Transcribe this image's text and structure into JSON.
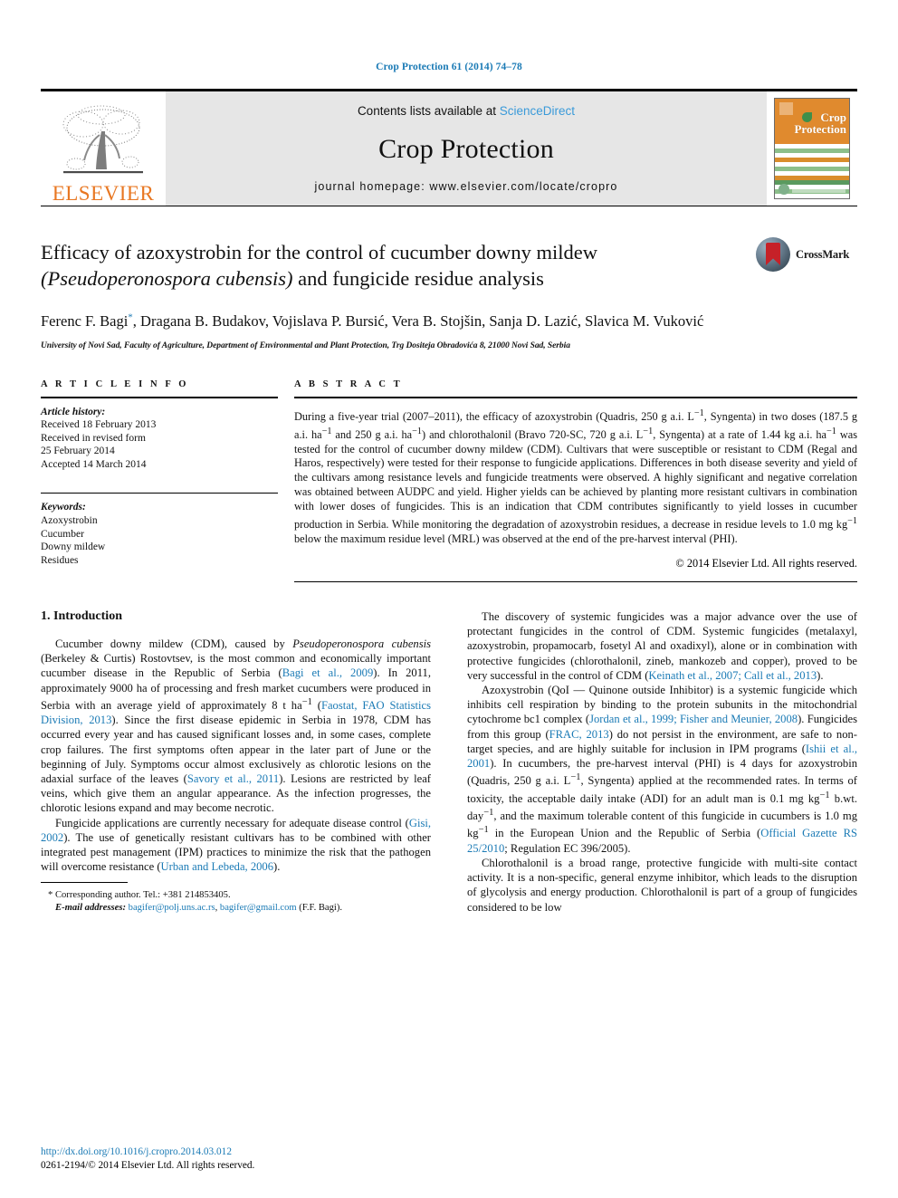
{
  "running_head": "Crop Protection 61 (2014) 74–78",
  "banner": {
    "publisher": "ELSEVIER",
    "contents_prefix": "Contents lists available at ",
    "contents_link": "ScienceDirect",
    "journal_name": "Crop Protection",
    "homepage": "journal homepage: www.elsevier.com/locate/cropro",
    "cover_title_line1": "Crop",
    "cover_title_line2": "Protection",
    "cover_stripe_colors": [
      "#ffffff",
      "#8cbf8a",
      "#ffffff",
      "#d98d2b",
      "#ffffff",
      "#8cbf8a",
      "#ffffff",
      "#d98d2b",
      "#5a9a5f",
      "#ffffff",
      "#8cbf8a",
      "#ffffff",
      "#d98d2b"
    ]
  },
  "article": {
    "title_line1": "Efficacy of azoxystrobin for the control of cucumber downy mildew",
    "title_italic": "(Pseudoperonospora cubensis)",
    "title_line2_rest": " and fungicide residue analysis",
    "crossmark_label": "CrossMark",
    "authors": "Ferenc F. Bagi, Dragana B. Budakov, Vojislava P. Bursić, Vera B. Stojšin, Sanja D. Lazić, Slavica M. Vuković",
    "author_star": "*",
    "affiliation": "University of Novi Sad, Faculty of Agriculture, Department of Environmental and Plant Protection, Trg Dositeja Obradovića 8, 21000 Novi Sad, Serbia"
  },
  "info": {
    "heading": "A R T I C L E   I N F O",
    "history_label": "Article history:",
    "history": [
      "Received 18 February 2013",
      "Received in revised form",
      "25 February 2014",
      "Accepted 14 March 2014"
    ],
    "keywords_label": "Keywords:",
    "keywords": [
      "Azoxystrobin",
      "Cucumber",
      "Downy mildew",
      "Residues"
    ]
  },
  "abstract": {
    "heading": "A B S T R A C T",
    "text": "During a five-year trial (2007–2011), the efficacy of azoxystrobin (Quadris, 250 g a.i. L−1, Syngenta) in two doses (187.5 g a.i. ha−1 and 250 g a.i. ha−1) and chlorothalonil (Bravo 720-SC, 720 g a.i. L−1, Syngenta) at a rate of 1.44 kg a.i. ha−1 was tested for the control of cucumber downy mildew (CDM). Cultivars that were susceptible or resistant to CDM (Regal and Haros, respectively) were tested for their response to fungicide applications. Differences in both disease severity and yield of the cultivars among resistance levels and fungicide treatments were observed. A highly significant and negative correlation was obtained between AUDPC and yield. Higher yields can be achieved by planting more resistant cultivars in combination with lower doses of fungicides. This is an indication that CDM contributes significantly to yield losses in cucumber production in Serbia. While monitoring the degradation of azoxystrobin residues, a decrease in residue levels to 1.0 mg kg−1 below the maximum residue level (MRL) was observed at the end of the pre-harvest interval (PHI).",
    "copyright": "© 2014 Elsevier Ltd. All rights reserved."
  },
  "body": {
    "section_number_title": "1.  Introduction",
    "left_paragraphs": [
      {
        "runs": [
          {
            "t": "Cucumber downy mildew (CDM), caused by "
          },
          {
            "t": "Pseudoperonospora cubensis",
            "s": "i"
          },
          {
            "t": " (Berkeley & Curtis) Rostovtsev, is the most common and economically important cucumber disease in the Republic of Serbia ("
          },
          {
            "t": "Bagi et al., 2009",
            "s": "ref"
          },
          {
            "t": "). In 2011, approximately 9000 ha of processing and fresh market cucumbers were produced in Serbia with an average yield of approximately 8 t ha"
          },
          {
            "t": "−1",
            "s": "sup"
          },
          {
            "t": " ("
          },
          {
            "t": "Faostat, FAO Statistics Division, 2013",
            "s": "ref"
          },
          {
            "t": "). Since the first disease epidemic in Serbia in 1978, CDM has occurred every year and has caused significant losses and, in some cases, complete crop failures. The first symptoms often appear in the later part of June or the beginning of July. Symptoms occur almost exclusively as chlorotic lesions on the adaxial surface of the leaves ("
          },
          {
            "t": "Savory et al., 2011",
            "s": "ref"
          },
          {
            "t": "). Lesions are restricted by leaf veins, which give them an angular appearance. As the infection progresses, the chlorotic lesions expand and may become necrotic."
          }
        ]
      },
      {
        "runs": [
          {
            "t": "Fungicide applications are currently necessary for adequate disease control ("
          },
          {
            "t": "Gisi, 2002",
            "s": "ref"
          },
          {
            "t": "). The use of genetically resistant cultivars has to be combined with other integrated pest management (IPM) practices to minimize the risk that the pathogen will overcome resistance ("
          },
          {
            "t": "Urban and Lebeda, 2006",
            "s": "ref"
          },
          {
            "t": ")."
          }
        ]
      }
    ],
    "right_paragraphs": [
      {
        "runs": [
          {
            "t": "The discovery of systemic fungicides was a major advance over the use of protectant fungicides in the control of CDM. Systemic fungicides (metalaxyl, azoxystrobin, propamocarb, fosetyl Al and oxadixyl), alone or in combination with protective fungicides (chlorothalonil, zineb, mankozeb and copper), proved to be very successful in the control of CDM ("
          },
          {
            "t": "Keinath et al., 2007; Call et al., 2013",
            "s": "ref"
          },
          {
            "t": ")."
          }
        ]
      },
      {
        "runs": [
          {
            "t": "Azoxystrobin (QoI — Quinone outside Inhibitor) is a systemic fungicide which inhibits cell respiration by binding to the protein subunits in the mitochondrial cytochrome bc1 complex ("
          },
          {
            "t": "Jordan et al., 1999; Fisher and Meunier, 2008",
            "s": "ref"
          },
          {
            "t": "). Fungicides from this group ("
          },
          {
            "t": "FRAC, 2013",
            "s": "ref"
          },
          {
            "t": ") do not persist in the environment, are safe to non-target species, and are highly suitable for inclusion in IPM programs ("
          },
          {
            "t": "Ishii et al., 2001",
            "s": "ref"
          },
          {
            "t": "). In cucumbers, the pre-harvest interval (PHI) is 4 days for azoxystrobin (Quadris, 250 g a.i. L"
          },
          {
            "t": "−1",
            "s": "sup"
          },
          {
            "t": ", Syngenta) applied at the recommended rates. In terms of toxicity, the acceptable daily intake (ADI) for an adult man is 0.1 mg kg"
          },
          {
            "t": "−1",
            "s": "sup"
          },
          {
            "t": " b.wt. day"
          },
          {
            "t": "−1",
            "s": "sup"
          },
          {
            "t": ", and the maximum tolerable content of this fungicide in cucumbers is 1.0 mg kg"
          },
          {
            "t": "−1",
            "s": "sup"
          },
          {
            "t": " in the European Union and the Republic of Serbia ("
          },
          {
            "t": "Official Gazette RS 25/2010",
            "s": "ref"
          },
          {
            "t": "; Regulation EC 396/2005)."
          }
        ]
      },
      {
        "runs": [
          {
            "t": "Chlorothalonil is a broad range, protective fungicide with multi-site contact activity. It is a non-specific, general enzyme inhibitor, which leads to the disruption of glycolysis and energy production. Chlorothalonil is part of a group of fungicides considered to be low"
          }
        ]
      }
    ]
  },
  "footnote": {
    "corresponding": "* Corresponding author. Tel.: +381 214853405.",
    "email_label": "E-mail addresses:",
    "email1": "bagifer@polj.uns.ac.rs",
    "email_sep": ", ",
    "email2": "bagifer@gmail.com",
    "email_suffix": " (F.F. Bagi)."
  },
  "page_footer": {
    "doi": "http://dx.doi.org/10.1016/j.cropro.2014.03.012",
    "issn_copyright": "0261-2194/© 2014 Elsevier Ltd. All rights reserved."
  },
  "colors": {
    "link_blue": "#1a7ab5",
    "elsevier_orange": "#E87722",
    "banner_grey": "#e6e6e6",
    "cover_orange": "#E08A2E",
    "crossmark_red": "#c62128"
  }
}
